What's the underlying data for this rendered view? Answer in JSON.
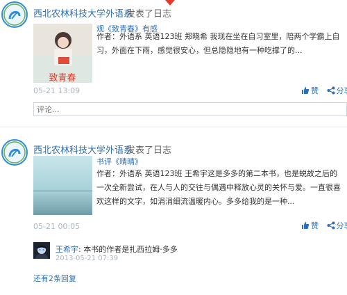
{
  "posts": [
    {
      "author": "西北农林科技大学外语系",
      "action": "发表了日志",
      "article_title": "观《致青春》有感",
      "article_body": "作者：外语系 英语123班 郑晓希 我现在坐在自习室里，陪两个学霸上自习，外面在下雨，感觉很安心，但总隐隐地有一种吃撑了的...",
      "thumb_text": "致青春",
      "time": "05-21 13:09",
      "like_label": "赞",
      "share_label": "分享",
      "comment_placeholder": "评论..."
    },
    {
      "author": "西北农林科技大学外语系",
      "action": "发表了日志",
      "article_title": "书评《晴晴》",
      "article_body": "作者：外语系 英语123班 王希宇这是多多的第二本书，也是蜕故之后的一次全新尝试，在人与人的交往与偶遇中释放心灵的关怀与爱。一直很喜欢这样的文字，如涓涓细流温暖内心。多多给我的是一种...",
      "time": "05-21 00:05",
      "like_label": "赞",
      "share_label": "分享",
      "reply": {
        "name": "王希宇",
        "text": ": 本书的作者是扎西拉姆·多多",
        "time": "2013-05-21 07:39"
      },
      "more_replies": "还有2条回复"
    }
  ],
  "colors": {
    "link_blue": "#2f6fb3",
    "time_gray": "#a9b6c4",
    "top_marker_red": "#e43b2c"
  }
}
